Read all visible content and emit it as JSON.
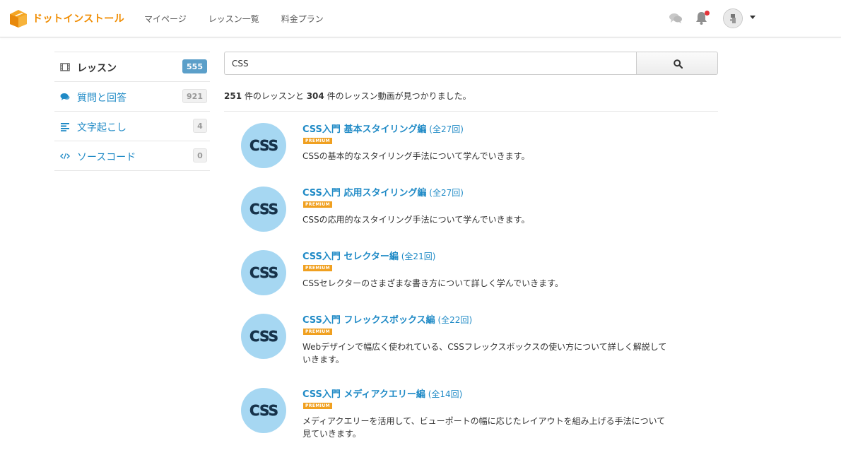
{
  "header": {
    "logo_text": "ドットインストール",
    "nav": [
      "マイページ",
      "レッスン一覧",
      "料金プラン"
    ]
  },
  "sidebar": {
    "items": [
      {
        "label": "レッスン",
        "count": "555",
        "icon": "film-icon"
      },
      {
        "label": "質問と回答",
        "count": "921",
        "icon": "comments-icon"
      },
      {
        "label": "文字起こし",
        "count": "4",
        "icon": "align-left-icon"
      },
      {
        "label": "ソースコード",
        "count": "0",
        "icon": "code-icon"
      }
    ]
  },
  "search": {
    "value": "CSS"
  },
  "summary": {
    "lesson_count": "251",
    "text1": " 件のレッスンと ",
    "video_count": "304",
    "text2": " 件のレッスン動画が見つかりました。"
  },
  "lessons": [
    {
      "thumb": "CSS",
      "title": "CSS入門 基本スタイリング編",
      "count": " (全27回)",
      "badge": "PREMIUM",
      "desc": "CSSの基本的なスタイリング手法について学んでいきます。"
    },
    {
      "thumb": "CSS",
      "title": "CSS入門 応用スタイリング編",
      "count": " (全27回)",
      "badge": "PREMIUM",
      "desc": "CSSの応用的なスタイリング手法について学んでいきます。"
    },
    {
      "thumb": "CSS",
      "title": "CSS入門 セレクター編",
      "count": " (全21回)",
      "badge": "PREMIUM",
      "desc": "CSSセレクターのさまざまな書き方について詳しく学んでいきます。"
    },
    {
      "thumb": "CSS",
      "title": "CSS入門 フレックスボックス編",
      "count": " (全22回)",
      "badge": "PREMIUM",
      "desc": "Webデザインで幅広く使われている、CSSフレックスボックスの使い方について詳しく解説していきます。"
    },
    {
      "thumb": "CSS",
      "title": "CSS入門 メディアクエリー編",
      "count": " (全14回)",
      "badge": "PREMIUM",
      "desc": "メディアクエリーを活用して、ビューポートの幅に応じたレイアウトを組み上げる手法について見ていきます。"
    }
  ],
  "colors": {
    "link": "#1f8ac6",
    "brand": "#f08c00",
    "premium": "#f0a020",
    "active_badge": "#5b9fc9",
    "notification_dot": "#e5343a"
  }
}
